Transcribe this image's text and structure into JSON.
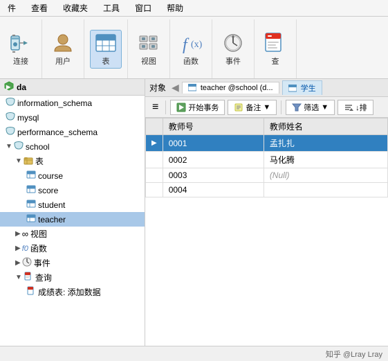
{
  "menu": {
    "items": [
      "件",
      "查看",
      "收藏夹",
      "工具",
      "窗口",
      "帮助"
    ]
  },
  "toolbar": {
    "connect_label": "连接",
    "user_label": "用户",
    "table_label": "表",
    "view_label": "视图",
    "function_label": "函数",
    "event_label": "事件",
    "query_label": "查"
  },
  "sidebar": {
    "header": "da",
    "items": [
      {
        "label": "information_schema",
        "level": 1,
        "type": "db",
        "expanded": false
      },
      {
        "label": "mysql",
        "level": 1,
        "type": "db",
        "expanded": false
      },
      {
        "label": "performance_schema",
        "level": 1,
        "type": "db",
        "expanded": false
      },
      {
        "label": "school",
        "level": 1,
        "type": "db",
        "expanded": true
      },
      {
        "label": "表",
        "level": 2,
        "type": "folder",
        "expanded": true
      },
      {
        "label": "course",
        "level": 3,
        "type": "table",
        "expanded": false
      },
      {
        "label": "score",
        "level": 3,
        "type": "table",
        "expanded": false
      },
      {
        "label": "student",
        "level": 3,
        "type": "table",
        "expanded": false
      },
      {
        "label": "teacher",
        "level": 3,
        "type": "table",
        "expanded": false,
        "selected": true
      },
      {
        "label": "视图",
        "level": 2,
        "type": "folder-view",
        "expanded": false
      },
      {
        "label": "函数",
        "level": 2,
        "type": "folder-func",
        "expanded": false
      },
      {
        "label": "事件",
        "level": 2,
        "type": "folder-event",
        "expanded": false
      },
      {
        "label": "查询",
        "level": 2,
        "type": "folder-query",
        "expanded": true
      },
      {
        "label": "成绩表: 添加数据",
        "level": 3,
        "type": "query",
        "expanded": false
      }
    ]
  },
  "content_header": {
    "object_label": "对象",
    "active_tab": "teacher @school (d...",
    "inactive_tab": "学生"
  },
  "content_toolbar": {
    "menu_icon": "≡",
    "start_transaction": "开始事务",
    "backup": "备注",
    "filter_separator": "▼",
    "filter_label": "筛选",
    "down_arrow": "↓排"
  },
  "table": {
    "columns": [
      "",
      "教师号",
      "教师姓名"
    ],
    "rows": [
      {
        "indicator": "▶",
        "id": "0001",
        "name": "孟扎扎",
        "selected": true
      },
      {
        "indicator": "",
        "id": "0002",
        "name": "马化腾",
        "selected": false
      },
      {
        "indicator": "",
        "id": "0003",
        "name": "(Null)",
        "selected": false,
        "null": true
      },
      {
        "indicator": "",
        "id": "0004",
        "name": "",
        "selected": false
      }
    ]
  },
  "status_bar": {
    "attribution": "知乎 @Lray Lray"
  }
}
